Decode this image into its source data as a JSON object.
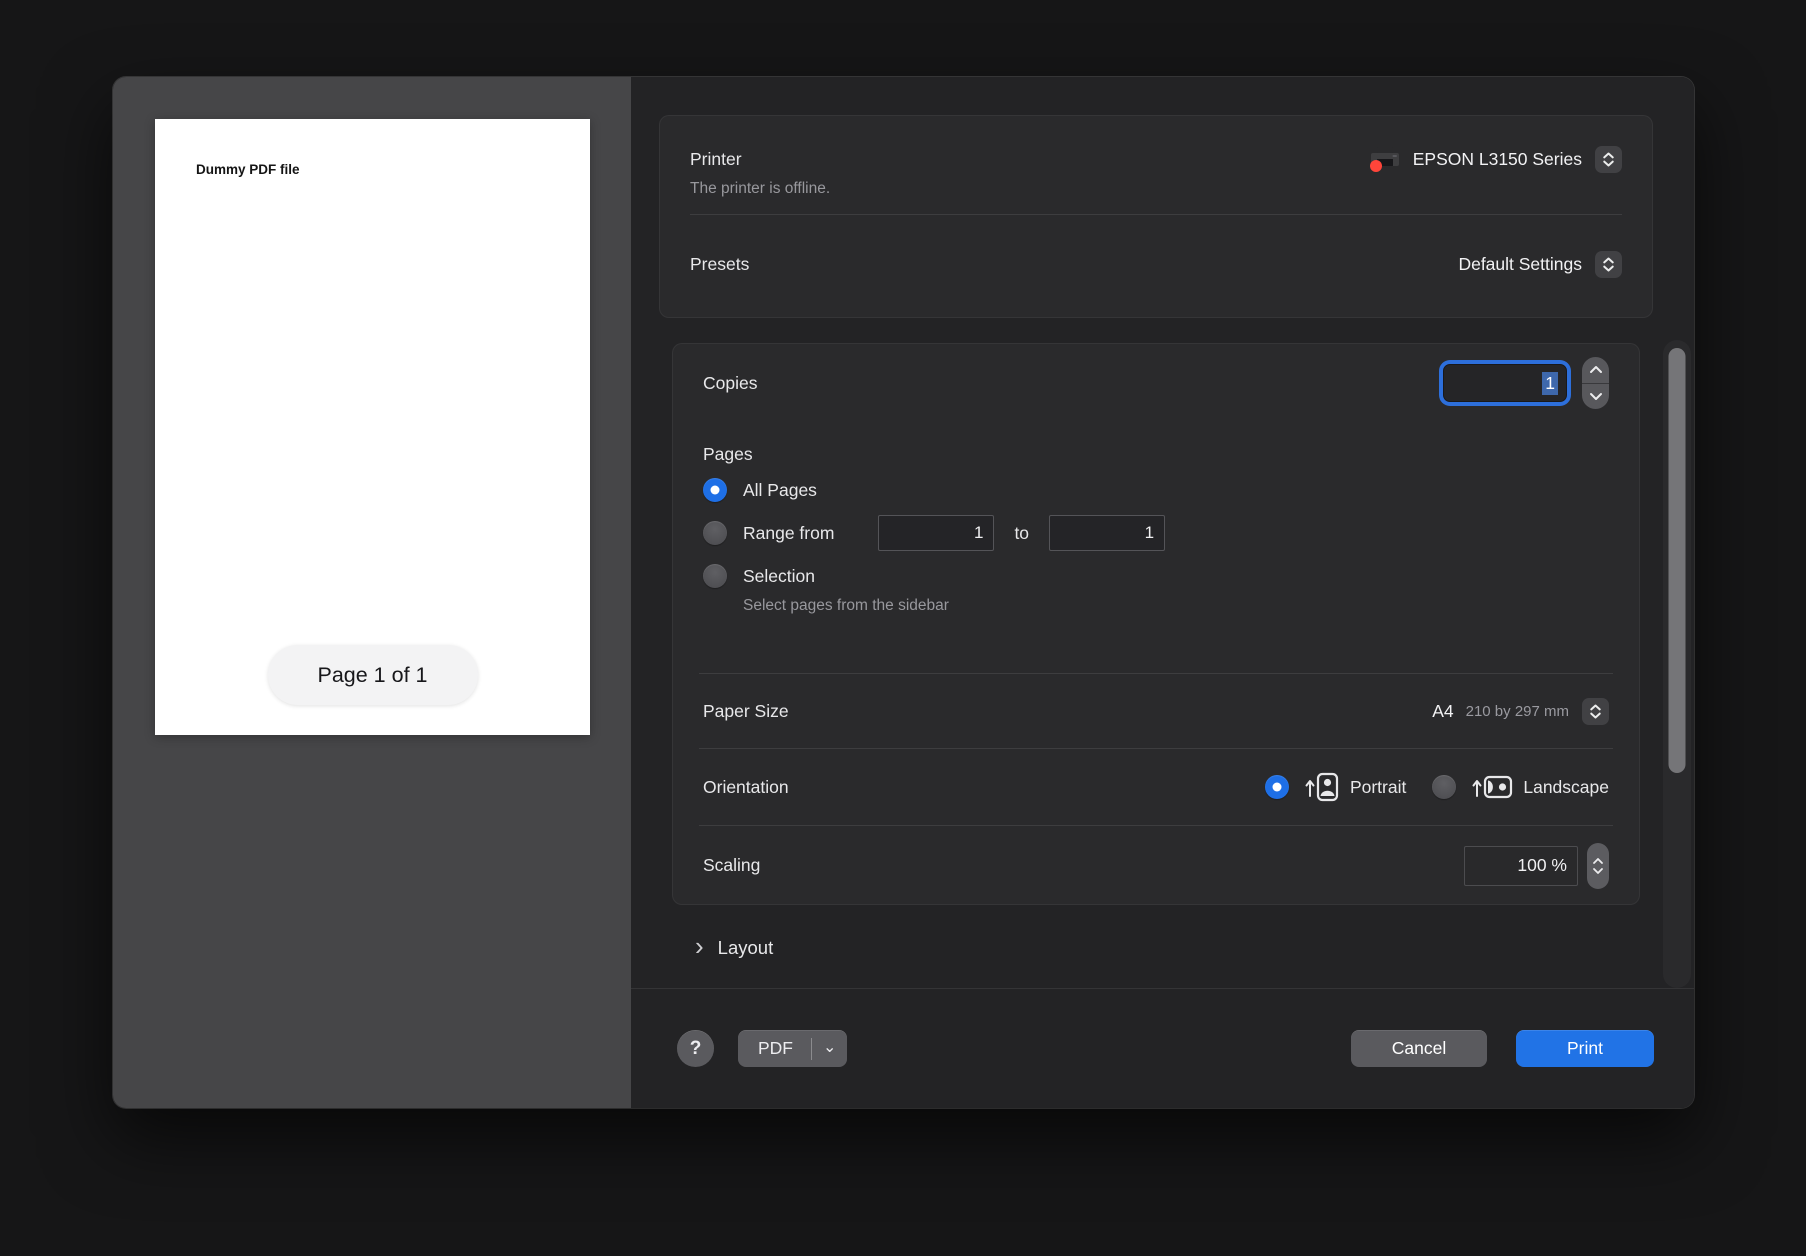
{
  "preview": {
    "document_text": "Dummy PDF file",
    "page_indicator": "Page 1 of 1"
  },
  "printer_card": {
    "printer": {
      "label": "Printer",
      "value": "EPSON L3150 Series",
      "status": "The printer is offline."
    },
    "presets": {
      "label": "Presets",
      "value": "Default Settings"
    }
  },
  "settings_card": {
    "copies": {
      "label": "Copies",
      "value": "1"
    },
    "pages": {
      "label": "Pages",
      "all_pages": "All Pages",
      "range_from": "Range from",
      "range_from_value": "1",
      "to": "to",
      "range_to_value": "1",
      "selection": "Selection",
      "selection_hint": "Select pages from the sidebar"
    },
    "paper_size": {
      "label": "Paper Size",
      "value": "A4",
      "detail": "210 by 297 mm"
    },
    "orientation": {
      "label": "Orientation",
      "portrait": "Portrait",
      "landscape": "Landscape"
    },
    "scaling": {
      "label": "Scaling",
      "value": "100 %"
    }
  },
  "layout_section": {
    "label": "Layout"
  },
  "footer": {
    "help": "?",
    "pdf": "PDF",
    "cancel": "Cancel",
    "print": "Print"
  },
  "icons": {
    "disclosure_chevron": "›",
    "pdf_chevron": "⌄"
  },
  "colors": {
    "accent_blue": "#1e6fe6",
    "print_button_blue": "#2173e6",
    "printer_status_dot_red": "#ff453a",
    "focus_ring_blue": "#2d6fdb"
  }
}
